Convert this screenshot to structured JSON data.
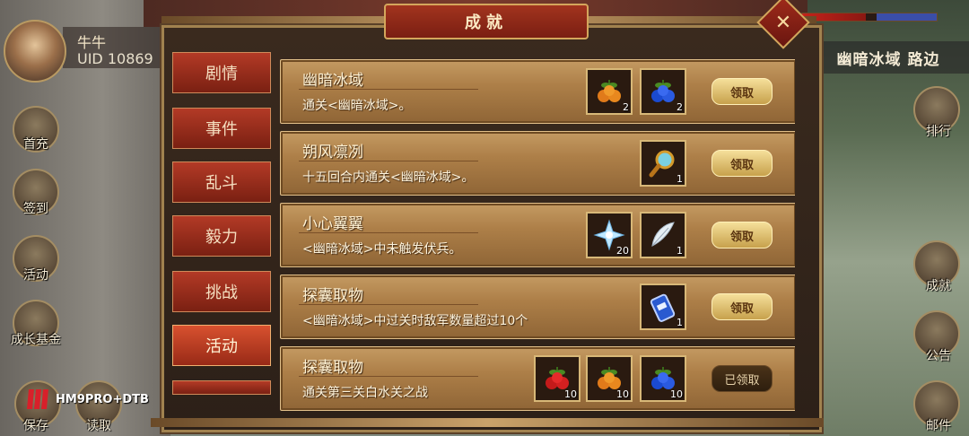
{
  "player": {
    "name": "牛牛",
    "uid": "UID 10869"
  },
  "map": {
    "location": "幽暗冰域 路边",
    "hp": 0.47
  },
  "left_buttons": [
    {
      "label": "首充",
      "icon": "gift-icon"
    },
    {
      "label": "签到",
      "icon": "scroll-icon"
    },
    {
      "label": "活动",
      "icon": "scroll-box-icon"
    },
    {
      "label": "成长基金",
      "icon": "tree-icon"
    },
    {
      "label": "保存",
      "icon": "save-icon"
    },
    {
      "label": "读取",
      "icon": "load-icon"
    }
  ],
  "right_buttons": [
    {
      "label": "排行",
      "icon": "banner-icon"
    },
    {
      "label": "成就",
      "icon": "achievement-icon"
    },
    {
      "label": "公告",
      "icon": "notice-icon"
    },
    {
      "label": "邮件",
      "icon": "mail-icon"
    }
  ],
  "dialog": {
    "title": "成就",
    "tabs": [
      "剧情",
      "事件",
      "乱斗",
      "毅力",
      "挑战",
      "活动"
    ],
    "active_tab": 5,
    "achievements": [
      {
        "title": "幽暗冰域",
        "desc": "通关<幽暗冰域>。",
        "rewards": [
          {
            "icon": "orange-fruit-icon",
            "qty": "2"
          },
          {
            "icon": "blue-fruit-icon",
            "qty": "2"
          }
        ],
        "button": "领取",
        "claimed": false
      },
      {
        "title": "朔风凛冽",
        "desc": "十五回合内通关<幽暗冰域>。",
        "rewards": [
          {
            "icon": "magnifier-icon",
            "qty": "1"
          }
        ],
        "button": "领取",
        "claimed": false
      },
      {
        "title": "小心翼翼",
        "desc": "<幽暗冰域>中未触发伏兵。",
        "rewards": [
          {
            "icon": "ice-crystal-icon",
            "qty": "20"
          },
          {
            "icon": "feather-icon",
            "qty": "1"
          }
        ],
        "button": "领取",
        "claimed": false
      },
      {
        "title": "探囊取物",
        "desc": "<幽暗冰域>中过关时敌军数量超过10个",
        "rewards": [
          {
            "icon": "scroll-item-icon",
            "qty": "1"
          }
        ],
        "button": "领取",
        "claimed": false
      },
      {
        "title": "探囊取物",
        "desc": "通关第三关白水关之战",
        "rewards": [
          {
            "icon": "red-fruit-icon",
            "qty": "10"
          },
          {
            "icon": "orange-fruit-icon",
            "qty": "10"
          },
          {
            "icon": "blue-fruit-icon",
            "qty": "10"
          }
        ],
        "button": "已领取",
        "claimed": true
      }
    ]
  },
  "watermark": "HM9PRO+DTB",
  "colors": {
    "tab_red": "#b33a26",
    "panel_gold": "#c49a62",
    "claim_gold": "#f5df9a"
  }
}
